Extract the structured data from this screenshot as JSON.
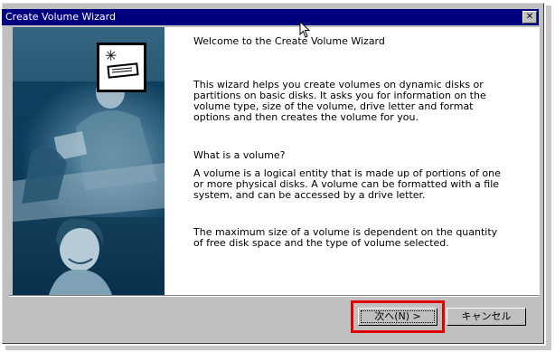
{
  "window": {
    "title": "Create Volume Wizard"
  },
  "icons": {
    "close": "close-icon",
    "logo": "wizard-disk-icon",
    "cursor": "mouse-pointer-icon"
  },
  "content": {
    "heading": "Welcome to the Create Volume Wizard",
    "intro": "This wizard helps you create volumes on dynamic disks or partitions on basic disks.  It asks you for information on the volume type, size of the volume, drive letter and format options and then creates the volume for you.",
    "question": "What is a volume?",
    "definition": "A volume is a logical entity that is made up of portions of one or more physical disks. A volume can be formatted with a file system, and can be accessed by a drive letter.",
    "max_size_note": "The maximum size of a volume is dependent on the quantity of free disk space and the type of volume selected."
  },
  "buttons": {
    "next": "次へ(N) >",
    "cancel": "キャンセル"
  },
  "colors": {
    "titlebar": "#00007f",
    "window_face": "#c0c0c0",
    "highlight_box": "#e00000",
    "panel_dark": "#0b3a5a"
  }
}
